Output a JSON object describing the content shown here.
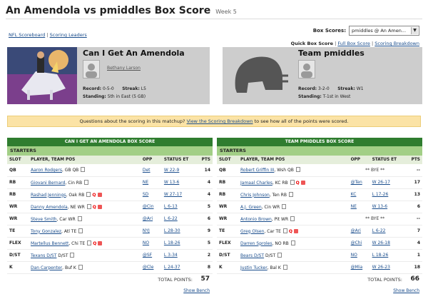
{
  "header": {
    "title": "An Amendola vs pmiddles Box Score",
    "week": "Week 5"
  },
  "top_links": {
    "scoreboard": "NFL Scoreboard",
    "sep": "|",
    "leaders": "Scoring Leaders"
  },
  "box_scores": {
    "label": "Box Scores:",
    "selected": "pmiddles @ An Amen..."
  },
  "quick_links": {
    "quick": "Quick Box Score",
    "sep1": "|",
    "full": "Full Box Score",
    "sep2": "|",
    "breakdown": "Scoring Breakdown"
  },
  "teams": [
    {
      "name": "Can I Get An Amendola",
      "owner": "Bethany Larson",
      "record_label": "Record:",
      "record": "0-5-0",
      "streak_label": "Streak:",
      "streak": "L5",
      "standing_label": "Standing:",
      "standing": "5th in East (5 GB)"
    },
    {
      "name": "Team pmiddles",
      "owner": "",
      "record_label": "Record:",
      "record": "3-2-0",
      "streak_label": "Streak:",
      "streak": "W1",
      "standing_label": "Standing:",
      "standing": "T-1st in West"
    }
  ],
  "banner": {
    "pre": "Questions about the scoring in this matchup?",
    "link": "View the Scoring Breakdown",
    "post": "to see how all of the points were scored."
  },
  "boxes": [
    {
      "title": "CAN I GET AN AMENDOLA BOX SCORE",
      "starters": "STARTERS",
      "columns": [
        "SLOT",
        "PLAYER, TEAM POS",
        "OPP",
        "STATUS ET",
        "PTS"
      ],
      "rows": [
        {
          "slot": "QB",
          "player": "Aaron Rodgers",
          "team_pos": ", GB QB",
          "opp": "Det",
          "status": "W 22-9",
          "pts": "14"
        },
        {
          "slot": "RB",
          "player": "Giovani Bernard",
          "team_pos": ", Cin RB",
          "opp": "NE",
          "status": "W 13-6",
          "pts": "4"
        },
        {
          "slot": "RB",
          "player": "Rashad Jennings",
          "team_pos": ", Oak RB",
          "q": "Q",
          "opp": "SD",
          "status": "W 27-17",
          "pts": "4"
        },
        {
          "slot": "WR",
          "player": "Danny Amendola",
          "team_pos": ", NE WR",
          "q": "Q",
          "opp": "@Cin",
          "status": "L 6-13",
          "pts": "5"
        },
        {
          "slot": "WR",
          "player": "Steve Smith",
          "team_pos": ", Car WR",
          "opp": "@Ari",
          "status": "L 6-22",
          "pts": "6"
        },
        {
          "slot": "TE",
          "player": "Tony Gonzalez",
          "team_pos": ", Atl TE",
          "opp": "NYJ",
          "status": "L 28-30",
          "pts": "9"
        },
        {
          "slot": "FLEX",
          "player": "Martellus Bennett",
          "team_pos": ", Chi TE",
          "q": "Q",
          "opp": "NO",
          "status": "L 18-26",
          "pts": "5"
        },
        {
          "slot": "D/ST",
          "player": "Texans D/ST",
          "team_pos": " D/ST",
          "opp": "@SF",
          "status": "L 3-34",
          "pts": "2"
        },
        {
          "slot": "K",
          "player": "Dan Carpenter",
          "team_pos": ", Buf K",
          "opp": "@Cle",
          "status": "L 24-37",
          "pts": "8"
        }
      ],
      "total_label": "TOTAL POINTS:",
      "total": "57",
      "bench": "Show Bench"
    },
    {
      "title": "TEAM PMIDDLES BOX SCORE",
      "starters": "STARTERS",
      "columns": [
        "SLOT",
        "PLAYER, TEAM POS",
        "OPP",
        "STATUS ET",
        "PTS"
      ],
      "rows": [
        {
          "slot": "QB",
          "player": "Robert Griffin III",
          "team_pos": ", Wsh QB",
          "bye": "** BYE **",
          "pts": "--"
        },
        {
          "slot": "RB",
          "player": "Jamaal Charles",
          "team_pos": ", KC RB",
          "q": "Q",
          "opp": "@Ten",
          "status": "W 26-17",
          "pts": "17"
        },
        {
          "slot": "RB",
          "player": "Chris Johnson",
          "team_pos": ", Ten RB",
          "opp": "KC",
          "status": "L 17-26",
          "pts": "13"
        },
        {
          "slot": "WR",
          "player": "A.J. Green",
          "team_pos": ", Cin WR",
          "opp": "NE",
          "status": "W 13-6",
          "pts": "6"
        },
        {
          "slot": "WR",
          "player": "Antonio Brown",
          "team_pos": ", Pit WR",
          "bye": "** BYE **",
          "pts": "--"
        },
        {
          "slot": "TE",
          "player": "Greg Olsen",
          "team_pos": ", Car TE",
          "q": "Q",
          "opp": "@Ari",
          "status": "L 6-22",
          "pts": "7"
        },
        {
          "slot": "FLEX",
          "player": "Darren Sproles",
          "team_pos": ", NO RB",
          "opp": "@Chi",
          "status": "W 26-18",
          "pts": "4"
        },
        {
          "slot": "D/ST",
          "player": "Bears D/ST",
          "team_pos": " D/ST",
          "opp": "NO",
          "status": "L 18-26",
          "pts": "1"
        },
        {
          "slot": "K",
          "player": "Justin Tucker",
          "team_pos": ", Bal K",
          "opp": "@Mia",
          "status": "W 26-23",
          "pts": "18"
        }
      ],
      "total_label": "TOTAL POINTS:",
      "total": "66",
      "bench": "Show Bench"
    }
  ],
  "colors": {
    "header_green": "#2f7d2f",
    "starters_green": "#a2cf86",
    "banner": "#fbe3a6",
    "link": "#1a4d8c",
    "questionable": "#e00000"
  }
}
